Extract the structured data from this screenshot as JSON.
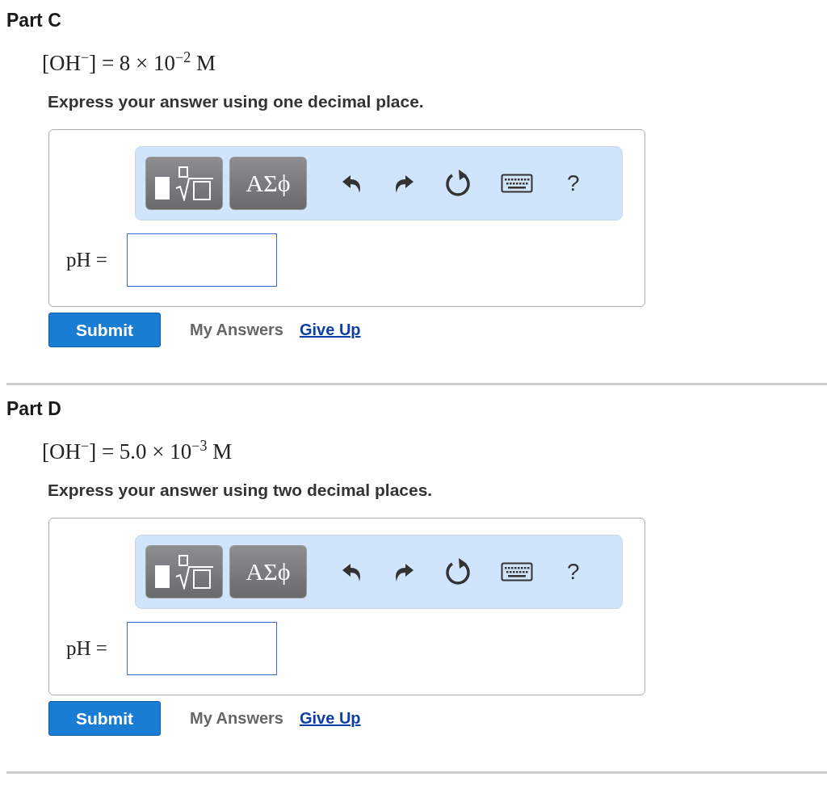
{
  "parts": [
    {
      "title": "Part C",
      "equation": "[OH$^{−}$] = 8 × 10$^{−2}$ M",
      "instruction": "Express your answer using one decimal place.",
      "toolbar": {
        "symbols_label": "ΑΣϕ",
        "help_label": "?"
      },
      "answer": {
        "label": "pH ="
      },
      "actions": [
        {
          "kind": "button",
          "label": "Submit"
        },
        {
          "kind": "plain",
          "label": "My Answers"
        },
        {
          "kind": "link",
          "label": "Give Up"
        }
      ]
    },
    {
      "title": "Part D",
      "equation": "[OH$^{−}$] = 5.0 × 10$^{−3}$ M",
      "instruction": "Express your answer using two decimal places.",
      "toolbar": {
        "symbols_label": "ΑΣϕ",
        "help_label": "?"
      },
      "answer": {
        "label": "pH ="
      },
      "actions": [
        {
          "kind": "button",
          "label": "Submit"
        },
        {
          "kind": "plain",
          "label": "My Answers"
        },
        {
          "kind": "link",
          "label": "Give Up"
        }
      ]
    }
  ]
}
